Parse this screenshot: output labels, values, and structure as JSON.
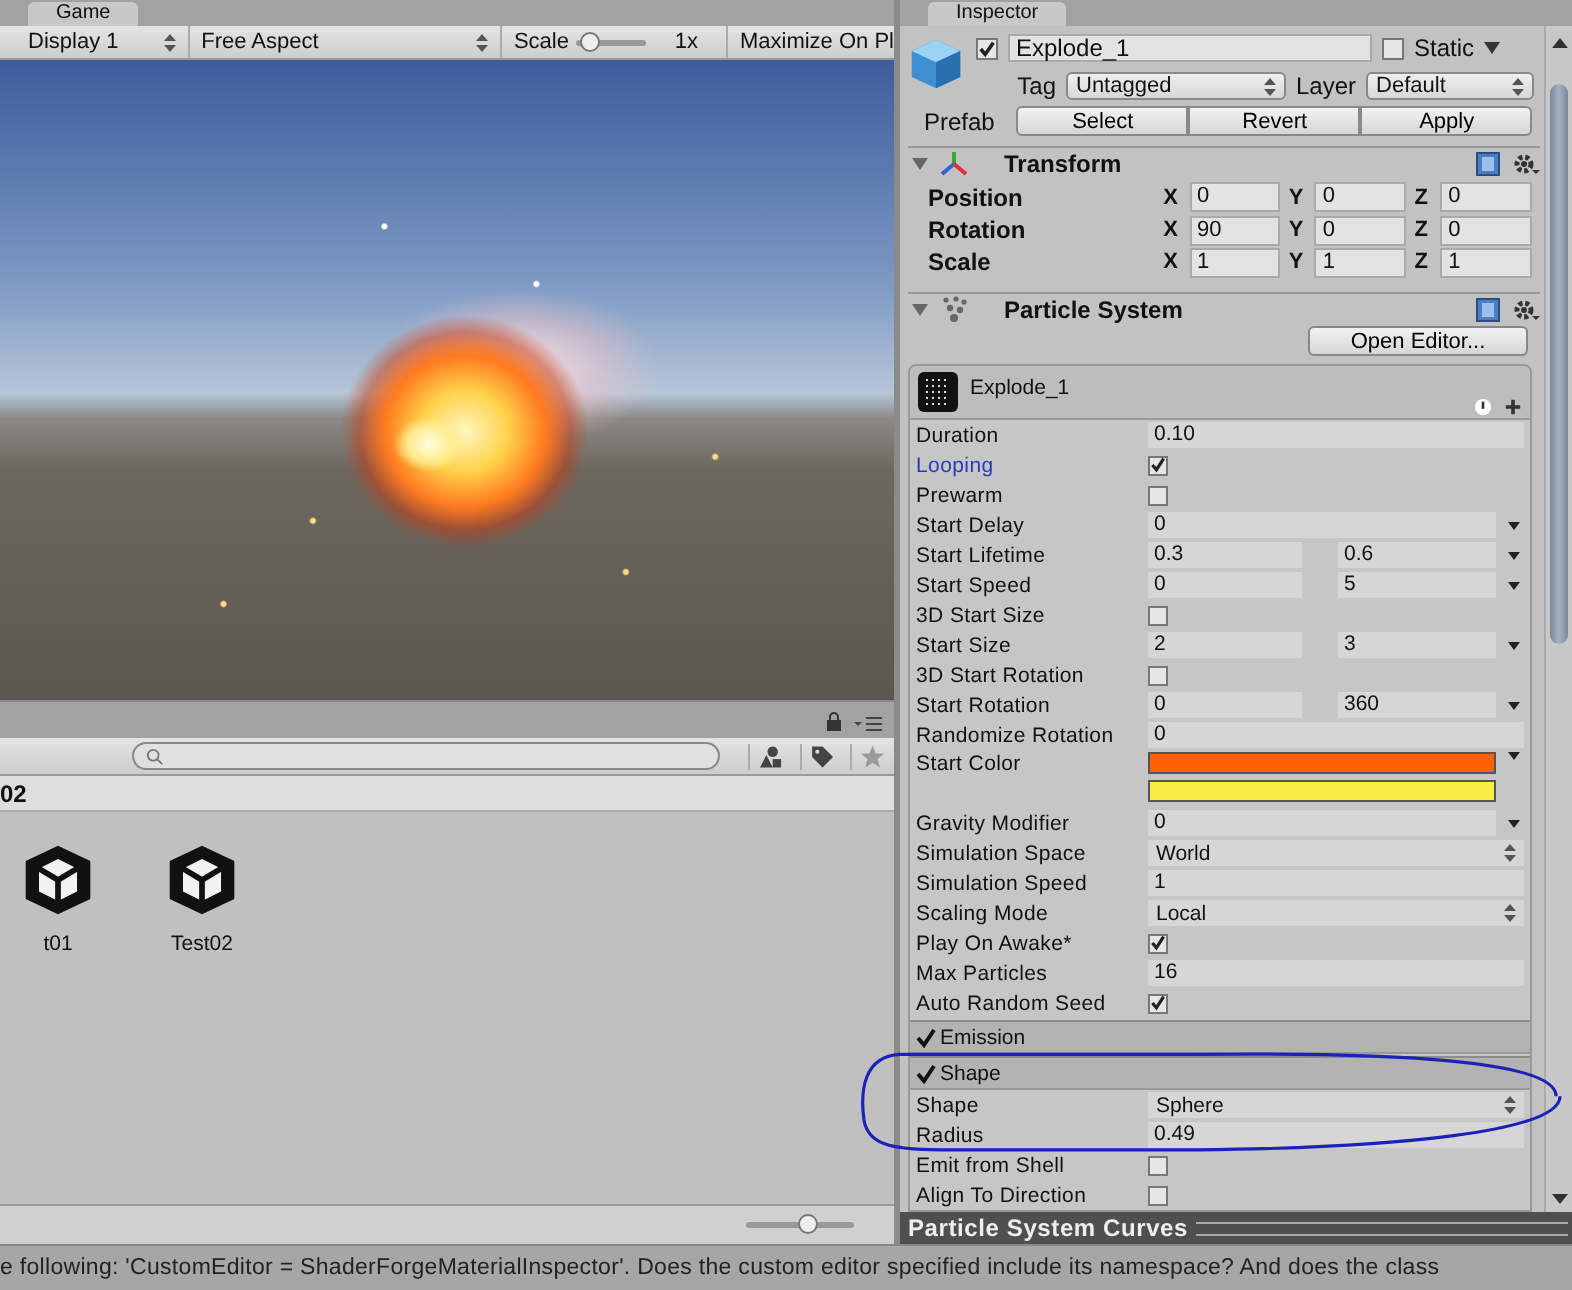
{
  "game": {
    "tab": "Game",
    "display": "Display 1",
    "aspect": "Free Aspect",
    "scale_label": "Scale",
    "scale": {
      "level": 0.05
    },
    "scale_value": "1x",
    "maximize": "Maximize On Pl"
  },
  "project": {
    "breadcrumb": "02",
    "assets": [
      {
        "name": "t01"
      },
      {
        "name": "Test02"
      }
    ],
    "zoom": {
      "level": 0.6
    }
  },
  "inspector": {
    "tab": "Inspector",
    "object": {
      "active": true,
      "name": "Explode_1",
      "static_label": "Static",
      "static": false,
      "tag_label": "Tag",
      "tag": "Untagged",
      "layer_label": "Layer",
      "layer": "Default",
      "prefab_label": "Prefab",
      "prefab_buttons": [
        "Select",
        "Revert",
        "Apply"
      ]
    },
    "transform": {
      "title": "Transform",
      "rows": [
        {
          "label": "Position",
          "values": [
            {
              "axis": "X",
              "value": "0"
            },
            {
              "axis": "Y",
              "value": "0"
            },
            {
              "axis": "Z",
              "value": "0"
            }
          ]
        },
        {
          "label": "Rotation",
          "values": [
            {
              "axis": "X",
              "value": "90"
            },
            {
              "axis": "Y",
              "value": "0"
            },
            {
              "axis": "Z",
              "value": "0"
            }
          ]
        },
        {
          "label": "Scale",
          "values": [
            {
              "axis": "X",
              "value": "1"
            },
            {
              "axis": "Y",
              "value": "1"
            },
            {
              "axis": "Z",
              "value": "1"
            }
          ]
        }
      ]
    },
    "particle_system": {
      "title": "Particle System",
      "open_editor": "Open Editor...",
      "system_name": "Explode_1",
      "rows": [
        {
          "kind": "field",
          "label": "Duration",
          "highlighted": false,
          "value": "0.10"
        },
        {
          "kind": "check",
          "label": "Looping",
          "highlighted": true,
          "checked": true
        },
        {
          "kind": "check",
          "label": "Prewarm",
          "highlighted": false,
          "checked": false
        },
        {
          "kind": "field_menu",
          "label": "Start Delay",
          "highlighted": false,
          "value": "0"
        },
        {
          "kind": "range",
          "label": "Start Lifetime",
          "highlighted": false,
          "values": [
            "0.3",
            "0.6"
          ]
        },
        {
          "kind": "range",
          "label": "Start Speed",
          "highlighted": false,
          "values": [
            "0",
            "5"
          ]
        },
        {
          "kind": "check",
          "label": "3D Start Size",
          "highlighted": false,
          "checked": false
        },
        {
          "kind": "range",
          "label": "Start Size",
          "highlighted": false,
          "values": [
            "2",
            "3"
          ]
        },
        {
          "kind": "check",
          "label": "3D Start Rotation",
          "highlighted": false,
          "checked": false
        },
        {
          "kind": "range",
          "label": "Start Rotation",
          "highlighted": false,
          "values": [
            "0",
            "360"
          ]
        },
        {
          "kind": "field",
          "label": "Randomize Rotation",
          "highlighted": false,
          "value": "0"
        },
        {
          "kind": "gradient",
          "label": "Start Color",
          "highlighted": false,
          "colors": [
            {
              "color": "#ff6000"
            },
            {
              "color": "#f8ec48"
            }
          ]
        },
        {
          "kind": "field_menu",
          "label": "Gravity Modifier",
          "highlighted": false,
          "value": "0"
        },
        {
          "kind": "select",
          "label": "Simulation Space",
          "highlighted": false,
          "value": "World"
        },
        {
          "kind": "field",
          "label": "Simulation Speed",
          "highlighted": false,
          "value": "1"
        },
        {
          "kind": "select",
          "label": "Scaling Mode",
          "highlighted": false,
          "value": "Local"
        },
        {
          "kind": "check",
          "label": "Play On Awake*",
          "highlighted": false,
          "checked": true
        },
        {
          "kind": "field",
          "label": "Max Particles",
          "highlighted": false,
          "value": "16"
        },
        {
          "kind": "check",
          "label": "Auto Random Seed",
          "highlighted": false,
          "checked": true
        }
      ],
      "modules": [
        {
          "name": "Emission",
          "enabled": true
        },
        {
          "name": "Shape",
          "enabled": true,
          "rows": [
            {
              "kind": "select",
              "label": "Shape",
              "highlighted": false,
              "value": "Sphere"
            },
            {
              "kind": "field",
              "label": "Radius",
              "highlighted": false,
              "value": "0.49"
            },
            {
              "kind": "check",
              "label": "Emit from Shell",
              "highlighted": false,
              "checked": false
            },
            {
              "kind": "check",
              "label": "Align To Direction",
              "highlighted": false,
              "checked": false
            }
          ]
        }
      ]
    },
    "curves_title": "Particle System Curves"
  },
  "status_bar": {
    "message": "e following: 'CustomEditor = ShaderForgeMaterialInspector'. Does the custom editor specified include its namespace? And does the class"
  }
}
